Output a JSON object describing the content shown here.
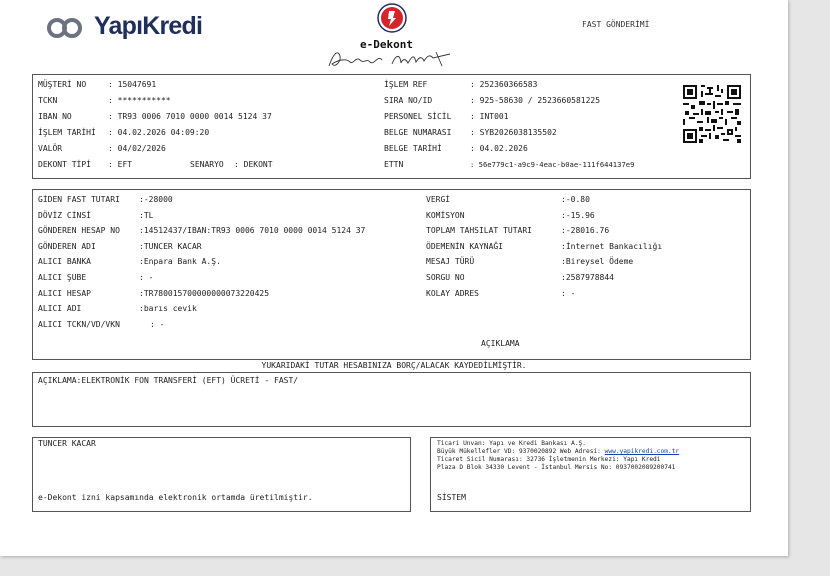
{
  "brand": {
    "logo_text": "YapıKredi",
    "colors": {
      "navy": "#1e2f5c",
      "red": "#d8232a"
    }
  },
  "header": {
    "title": "e-Dekont",
    "doc_type": "FAST GÖNDERİMİ"
  },
  "info_left": [
    {
      "label": "MÜŞTERİ NO",
      "value": ": 15047691"
    },
    {
      "label": "TCKN",
      "value": ": ***********"
    },
    {
      "label": "IBAN NO",
      "value": ": TR93 0006 7010 0000 0014 5124 37"
    },
    {
      "label": "İŞLEM TARİHİ",
      "value": ": 04.02.2026 04:09:20"
    },
    {
      "label": "VALÖR",
      "value": ": 04/02/2026"
    },
    {
      "label": "DEKONT TİPİ",
      "value": ": EFT"
    }
  ],
  "senaryo": {
    "label": "SENARYO",
    "value": ": DEKONT"
  },
  "info_right": [
    {
      "label": "İŞLEM REF",
      "value": ": 252360366583"
    },
    {
      "label": "SIRA NO/ID",
      "value": ": 925-58630 / 2523660581225"
    },
    {
      "label": "PERSONEL SİCİL",
      "value": ": INT001"
    },
    {
      "label": "BELGE NUMARASI",
      "value": ": SYB2026038135502"
    },
    {
      "label": "BELGE TARİHİ",
      "value": ": 04.02.2026"
    },
    {
      "label": "ETTN",
      "value": ": 56e779c1-a9c9-4eac-b0ae-111f644137e9"
    }
  ],
  "tx_left": [
    {
      "label": "GİDEN FAST TUTARI",
      "value": ":-28000"
    },
    {
      "label": "DÖVİZ CİNSİ",
      "value": ":TL"
    },
    {
      "label": "GÖNDEREN HESAP NO",
      "value": ":14512437/IBAN:TR93 0006 7010 0000 0014 5124 37"
    },
    {
      "label": "GÖNDEREN ADI",
      "value": ":TUNCER KACAR"
    },
    {
      "label": "ALICI BANKA",
      "value": ":Enpara Bank A.Ş."
    },
    {
      "label": "ALICI ŞUBE",
      "value": ": -"
    },
    {
      "label": "ALICI HESAP",
      "value": ":TR780015700000000073220425"
    },
    {
      "label": "ALICI ADI",
      "value": ":barıs cevik"
    },
    {
      "label": "ALICI TCKN/VD/VKN",
      "value": ": -"
    }
  ],
  "tx_right": [
    {
      "label": "VERGİ",
      "value": ":-0.80"
    },
    {
      "label": "KOMİSYON",
      "value": ":-15.96"
    },
    {
      "label": "TOPLAM TAHSILAT TUTARI",
      "value": ":-28016.76"
    },
    {
      "label": "ÖDEMENİN KAYNAĞI",
      "value": ":İnternet Bankacılığı"
    },
    {
      "label": "MESAJ TÜRÜ",
      "value": ":Bireysel Ödeme"
    },
    {
      "label": "SORGU NO",
      "value": ":2587978844"
    },
    {
      "label": "KOLAY ADRES",
      "value": ": -"
    }
  ],
  "aciklama_heading": "AÇIKLAMA",
  "notice": "YUKARIDAKİ TUTAR HESABINIZA BORÇ/ALACAK KAYDEDİLMİŞTİR.",
  "description": "AÇIKLAMA:ELEKTRONİK FON TRANSFERİ (EFT) ÜCRETİ - FAST/",
  "footer": {
    "customer_name": "TUNCER KACAR",
    "e_note": "e-Dekont izni kapsamında elektronik ortamda üretilmiştir.",
    "bank_line1": "Ticari Unvan: Yapı ve Kredi Bankası A.Ş.",
    "bank_line2_prefix": "Büyük Mükellefler VD: 9370020892 Web Adresi: ",
    "bank_link": "www.yapikredi.com.tr",
    "bank_line3": "Ticaret Sicil Numarası: 32736 İşletmenin Merkezi: Yapı Kredi",
    "bank_line4": "Plaza D Blok 34330 Levent - İstanbul Mersis No: 0937002089200741",
    "system": "SİSTEM"
  }
}
